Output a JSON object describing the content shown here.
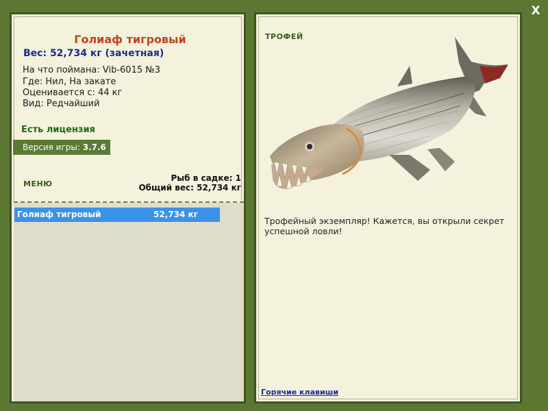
{
  "window": {
    "close_label": "X"
  },
  "catch": {
    "title": "Голиаф тигровый",
    "weight": "Вес: 52,734 кг (зачетная)",
    "info": [
      "На что поймана: Vib-6015 №3",
      "Где: Нил, На закате",
      "Оценивается с: 44 кг",
      "Вид: Редчайший"
    ],
    "license": "Есть лицензия",
    "version_label": "Версия игры: ",
    "version_value": "3.7.6"
  },
  "menu": {
    "label": "МЕНЮ",
    "fish_in_keepnet": "Рыб в садке: 1",
    "total_weight": "Общий вес: 52,734 кг"
  },
  "keepnet": {
    "rows": [
      {
        "name": "Голиаф тигровый",
        "weight": "52,734 кг"
      }
    ]
  },
  "trophy": {
    "label": "ТРОФЕЙ",
    "message": "Трофейный экземпляр! Кажется, вы открыли секрет успешной ловли!",
    "hotkeys_link": "Горячие клавиши"
  },
  "colors": {
    "frame": "#5b7731",
    "panel_bg": "#f4f2dc",
    "title_orange": "#c0441d",
    "weight_blue": "#1d2c8c",
    "license_green": "#1d6a14",
    "selected_row": "#3a93e8"
  },
  "icons": {
    "close": "close-icon",
    "fish": "goliath-tigerfish-illustration"
  }
}
